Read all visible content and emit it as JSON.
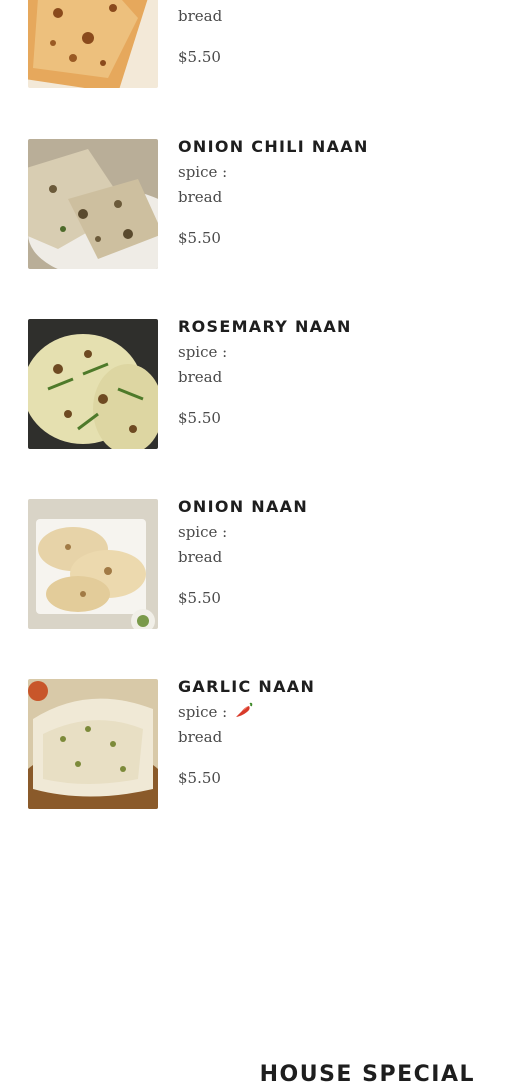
{
  "menu": {
    "spice_label": "spice :",
    "items": [
      {
        "name": "",
        "spice_level": 0,
        "category": "bread",
        "price": "$5.50",
        "image_icon": "naan-photo-icon",
        "colors": {
          "bg": "#e6a85c",
          "spot": "#8a4a1c"
        }
      },
      {
        "name": "ONION CHILI NAAN",
        "spice_level": 0,
        "category": "bread",
        "price": "$5.50",
        "image_icon": "onion-chili-naan-photo-icon",
        "colors": {
          "bg": "#cfc6b4",
          "spot": "#6b5a3a"
        }
      },
      {
        "name": "ROSEMARY NAAN",
        "spice_level": 0,
        "category": "bread",
        "price": "$5.50",
        "image_icon": "rosemary-naan-photo-icon",
        "colors": {
          "bg": "#2f2f2c",
          "spot": "#e5e0b0"
        }
      },
      {
        "name": "ONION NAAN",
        "spice_level": 0,
        "category": "bread",
        "price": "$5.50",
        "image_icon": "onion-naan-photo-icon",
        "colors": {
          "bg": "#d9d4c7",
          "spot": "#a17a45"
        }
      },
      {
        "name": "GARLIC NAAN",
        "spice_level": 1,
        "category": "bread",
        "price": "$5.50",
        "image_icon": "garlic-naan-photo-icon",
        "colors": {
          "bg": "#d8c9a8",
          "spot": "#7c8a3a"
        }
      }
    ]
  },
  "section": {
    "title": "HOUSE SPECIAL"
  },
  "colors": {
    "heading": "#1e1e1e",
    "text": "#4a4a4a",
    "chili": "#d83a2a"
  }
}
